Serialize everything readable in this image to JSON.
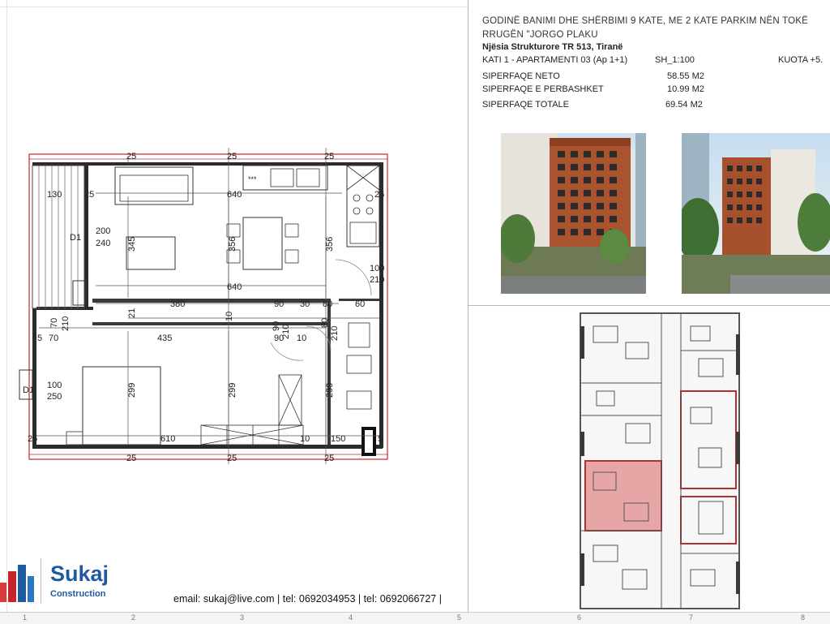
{
  "header": {
    "title_line1": "GODINË BANIMI DHE SHËRBIMI 9 KATE, ME 2 KATE PARKIM NËN TOKË",
    "title_line2": "RRUGËN \"JORGO PLAKU",
    "unit": "Njësia Strukturore TR 513,  Tiranë",
    "floor": "KATI 1 - APARTAMENTI 03 (Ap 1+1)",
    "scale": "SH_1:100",
    "level": "KUOTA +5."
  },
  "areas": [
    {
      "label": "SIPERFAQE NETO",
      "value": "58.55  M2"
    },
    {
      "label": "SIPERFAQE E PERBASHKET",
      "value": "10.99 M2"
    },
    {
      "label": "SIPERFAQE TOTALE",
      "value": "69.54 M2"
    }
  ],
  "plan": {
    "dims": {
      "d25a": "25",
      "d25b": "25",
      "d25c": "25",
      "d25d": "25",
      "d25e": "25",
      "d130": "130",
      "d640a": "640",
      "d640b": "640",
      "d345": "345",
      "d356a": "356",
      "d356b": "356",
      "d200": "200",
      "d240": "240",
      "d100a": "100",
      "d210a": "210",
      "d380": "380",
      "d90a": "90",
      "d30": "30",
      "d80a": "80",
      "d60": "60",
      "d70a": "70",
      "d210b": "210",
      "d5": "5",
      "d70b": "70",
      "d435": "435",
      "d90b": "90",
      "d210c": "210",
      "d10a": "10",
      "d80b": "80",
      "d210d": "210",
      "d90c": "90",
      "d10b": "10",
      "d21": "21",
      "d10c": "10",
      "d100b": "100",
      "d250": "250",
      "d299a": "299",
      "d299b": "299",
      "d299c": "299",
      "d610": "610",
      "d10d": "10",
      "d150": "150",
      "d5b": "5",
      "d25f": "25",
      "d25g": "25",
      "d25h": "25",
      "d25i": "25"
    },
    "labels": {
      "d1a": "D1",
      "d1b": "D1",
      "stars": "***"
    }
  },
  "footer": {
    "contact": "email: sukaj@live.com | tel: 0692034953 | tel: 0692066727 |"
  },
  "logo": {
    "name": "Sukaj",
    "sub": "Construction"
  },
  "ruler": {
    "n1": "1",
    "n2": "2",
    "n3": "3",
    "n4": "4",
    "n5": "5",
    "n6": "6",
    "n7": "7",
    "n8": "8"
  },
  "colors": {
    "accent_red": "#c8242c",
    "highlight": "#e6a6a6",
    "brick": "#b35a35",
    "logo_blue": "#1f5a9e"
  }
}
